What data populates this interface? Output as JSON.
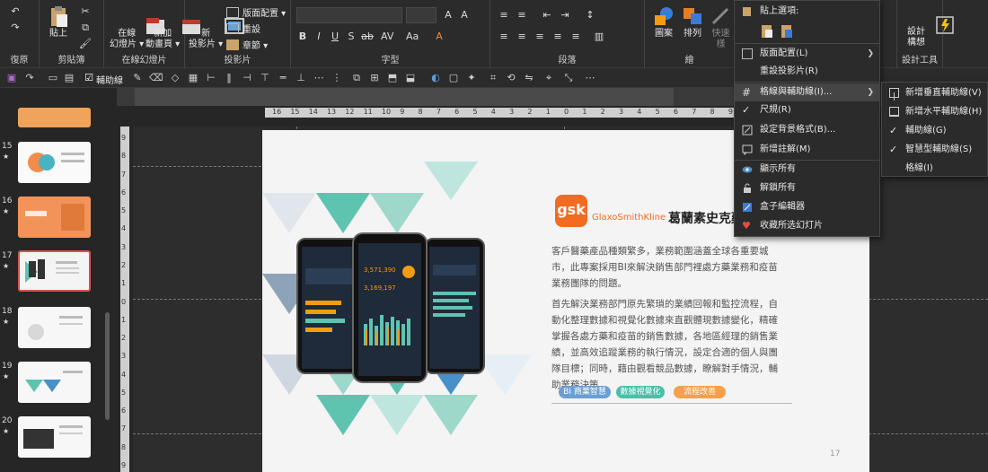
{
  "colors": {
    "accent_red": "#c0392b",
    "accent_orange": "#f39c12",
    "brand_gsk": "#f26b21",
    "teal": "#5ec4b0",
    "blue": "#4a90c8",
    "tag_blue": "#6a9fd4",
    "tag_teal": "#4bbfa8",
    "tag_orange": "#f5a04a"
  },
  "ribbon": {
    "clipboard": {
      "label": "剪貼簿",
      "paste": "貼上",
      "undo": "復原"
    },
    "online": {
      "label": "在線幻燈片",
      "online_slides": "在線\n幻燈片 ▾",
      "add_anim": "新加\n動畫頁 ▾"
    },
    "slides": {
      "label": "投影片",
      "new_slide": "新\n投影片 ▾",
      "layout": "版面配置 ▾",
      "reset": "重設",
      "section": "章節 ▾"
    },
    "font": {
      "label": "字型"
    },
    "paragraph": {
      "label": "段落"
    },
    "drawing": {
      "label": "繪",
      "shape": "圖案",
      "arrange": "排列",
      "quick_styles": "快速樣"
    },
    "designer": {
      "label": "設計工具",
      "design_ideas": "設計\n構想"
    }
  },
  "qat": {
    "guides": "輔助線"
  },
  "thumbnails": [
    {
      "num": "15",
      "star": "★"
    },
    {
      "num": "16",
      "star": "★"
    },
    {
      "num": "17",
      "star": "★"
    },
    {
      "num": "18",
      "star": "★"
    },
    {
      "num": "19",
      "star": "★"
    },
    {
      "num": "20",
      "star": "★"
    }
  ],
  "rulers": {
    "h_ticks": [
      "16",
      "15",
      "14",
      "13",
      "12",
      "11",
      "10",
      "9",
      "8",
      "7",
      "6",
      "5",
      "4",
      "3",
      "2",
      "1",
      "0",
      "1",
      "2",
      "3",
      "4",
      "5",
      "6",
      "7",
      "8",
      "9",
      "10",
      "11",
      "12",
      "13",
      "14",
      "15",
      "16"
    ],
    "v_ticks": [
      "9",
      "8",
      "7",
      "6",
      "5",
      "4",
      "3",
      "2",
      "1",
      "0",
      "1",
      "2",
      "3",
      "4",
      "5",
      "6",
      "7",
      "8",
      "9"
    ]
  },
  "slide": {
    "logo_text": "gsk",
    "logo_sub": "GlaxoSmithKline",
    "title": "葛蘭素史克藥",
    "para1": "客戶醫藥產品種類繁多，業務範圍涵蓋全球各重要城市，此專案採用BI來解決銷售部門裡處方藥業務和疫苗業務團隊的問題。",
    "para2": "首先解決業務部門原先繁瑣的業績回報和監控流程，自動化整理數據和視覺化數據來直觀體現數據變化，精確掌握各處方藥和疫苗的銷售數據，各地區經理的銷售業績，並高效追蹤業務的執行情況，設定合適的個人與團隊目標；同時，藉由觀看競品數據，瞭解對手情況，輔助業務決策。",
    "tags": [
      "BI 商業智慧",
      "數據視覺化",
      "流程改善"
    ],
    "page_num": "17",
    "phone_values": [
      "3,571,390",
      "3,169,197"
    ]
  },
  "context_menu": {
    "paste_options": "貼上選項:",
    "layout": "版面配置(L)",
    "reset_slide": "重設投影片(R)",
    "grid_guides": "格線與輔助線(I)...",
    "ruler": "尺規(R)",
    "format_bg": "設定背景格式(B)...",
    "new_comment": "新增註解(M)",
    "show_all": "顯示所有",
    "unlock_all": "解鎖所有",
    "box_editor": "盒子編輯器",
    "favorite": "收藏所选幻灯片"
  },
  "submenu": {
    "add_vertical": "新增垂直輔助線(V)",
    "add_horizontal": "新增水平輔助線(H)",
    "guides": "輔助線(G)",
    "smart_guides": "智慧型輔助線(S)",
    "gridlines": "格線(I)"
  }
}
